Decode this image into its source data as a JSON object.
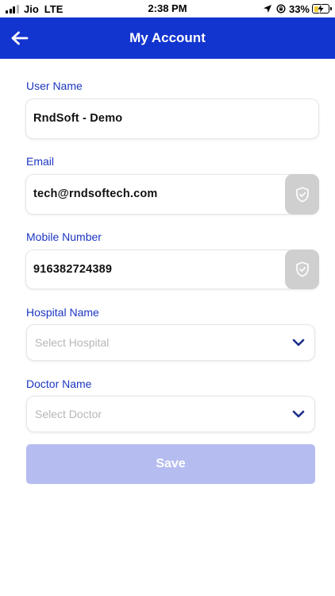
{
  "status_bar": {
    "carrier": "Jio",
    "network": "LTE",
    "time": "2:38 PM",
    "battery_percent_label": "33%",
    "battery_level": 0.33,
    "battery_color": "#f2cc2f"
  },
  "header": {
    "title": "My Account",
    "back_icon": "back-arrow-icon",
    "background_color": "#1234cf"
  },
  "form": {
    "user_name": {
      "label": "User Name",
      "value": "RndSoft - Demo"
    },
    "email": {
      "label": "Email",
      "value": "tech@rndsoftech.com",
      "verify_icon": "shield-check-icon"
    },
    "mobile": {
      "label": "Mobile Number",
      "value": "916382724389",
      "verify_icon": "shield-check-icon"
    },
    "hospital": {
      "label": "Hospital Name",
      "placeholder": "Select Hospital",
      "icon": "chevron-down-icon"
    },
    "doctor": {
      "label": "Doctor Name",
      "placeholder": "Select Doctor",
      "icon": "chevron-down-icon"
    }
  },
  "save_button": {
    "label": "Save",
    "color": "#b4bcf0"
  }
}
